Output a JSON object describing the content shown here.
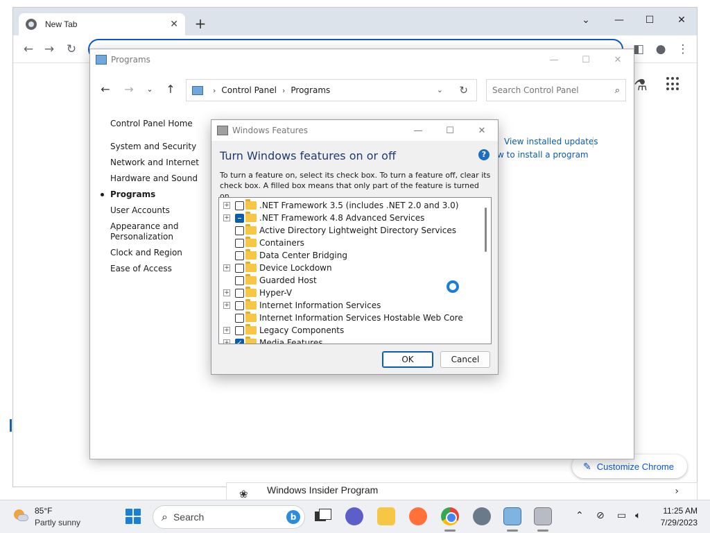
{
  "chrome": {
    "tab_title": "New Tab",
    "tab_close": "✕",
    "new_tab": "+",
    "minimize": "⌄",
    "restore": "—",
    "maximize": "☐",
    "close": "✕",
    "back": "←",
    "forward": "→",
    "reload": "↻",
    "customize_label": "Customize Chrome",
    "apps_icon": "apps-grid-icon",
    "accent_color": "#0b57d0"
  },
  "insider": {
    "title": "Windows Insider Program"
  },
  "control_panel": {
    "title": "Programs",
    "breadcrumb": [
      "Control Panel",
      "Programs"
    ],
    "search_placeholder": "Search Control Panel",
    "sidebar": {
      "home": "Control Panel Home",
      "items": [
        {
          "label": "System and Security"
        },
        {
          "label": "Network and Internet"
        },
        {
          "label": "Hardware and Sound"
        },
        {
          "label": "Programs",
          "active": true
        },
        {
          "label": "User Accounts"
        },
        {
          "label": "Appearance and Personalization"
        },
        {
          "label": "Clock and Region"
        },
        {
          "label": "Ease of Access"
        }
      ]
    },
    "links": {
      "view_updates": "View installed updates",
      "install_program": "w to install a program"
    }
  },
  "windows_features": {
    "title": "Windows Features",
    "heading": "Turn Windows features on or off",
    "description": "To turn a feature on, select its check box. To turn a feature off, clear its check box. A filled box means that only part of the feature is turned on.",
    "features": [
      {
        "label": ".NET Framework 3.5 (includes .NET 2.0 and 3.0)",
        "expandable": true,
        "state": "unchecked"
      },
      {
        "label": ".NET Framework 4.8 Advanced Services",
        "expandable": true,
        "state": "partial"
      },
      {
        "label": "Active Directory Lightweight Directory Services",
        "expandable": false,
        "state": "unchecked"
      },
      {
        "label": "Containers",
        "expandable": false,
        "state": "unchecked"
      },
      {
        "label": "Data Center Bridging",
        "expandable": false,
        "state": "unchecked"
      },
      {
        "label": "Device Lockdown",
        "expandable": true,
        "state": "unchecked"
      },
      {
        "label": "Guarded Host",
        "expandable": false,
        "state": "unchecked"
      },
      {
        "label": "Hyper-V",
        "expandable": true,
        "state": "unchecked"
      },
      {
        "label": "Internet Information Services",
        "expandable": true,
        "state": "unchecked"
      },
      {
        "label": "Internet Information Services Hostable Web Core",
        "expandable": false,
        "state": "unchecked"
      },
      {
        "label": "Legacy Components",
        "expandable": true,
        "state": "unchecked"
      },
      {
        "label": "Media Features",
        "expandable": true,
        "state": "checked"
      }
    ],
    "ok_label": "OK",
    "cancel_label": "Cancel",
    "help_glyph": "?"
  },
  "taskbar": {
    "weather_temp": "85°F",
    "weather_desc": "Partly sunny",
    "search_label": "Search",
    "time": "11:25 AM",
    "date": "7/29/2023"
  }
}
